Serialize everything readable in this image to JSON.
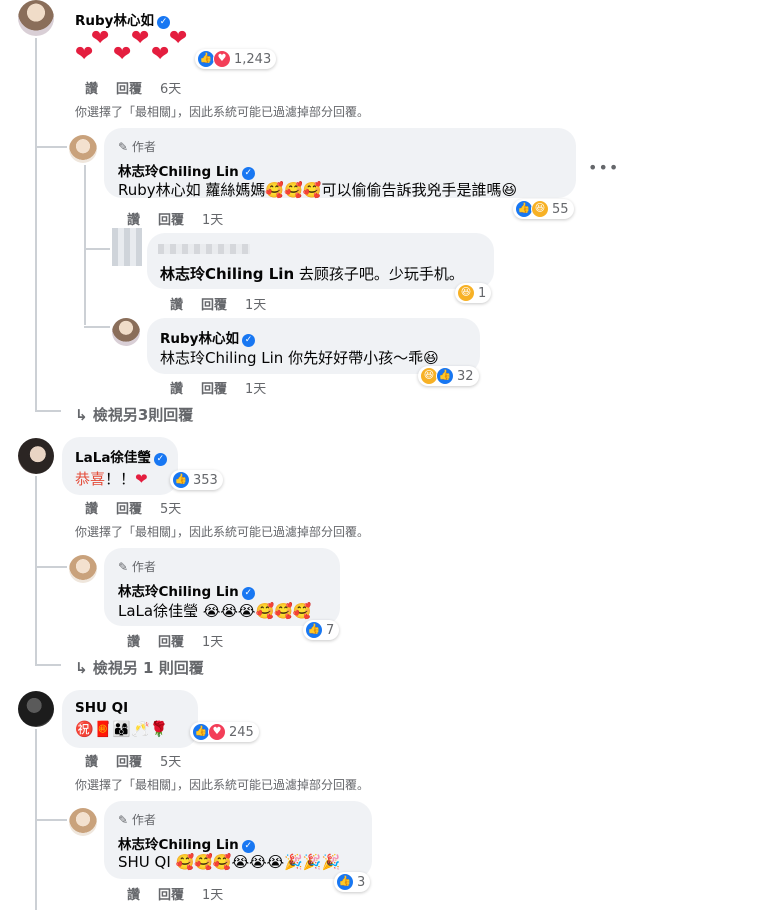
{
  "reply_label": "讚",
  "reply_btn": "回覆",
  "author_label": "作者",
  "filter_note": "你選擇了「最相關」，因此系統可能已過濾掉部分回覆。",
  "comments": [
    {
      "name": "Ruby林心如",
      "text": "❤️❤️❤️❤️❤️",
      "time": "6天",
      "count": "1,243",
      "avatar_color": "#c9b7a6"
    },
    {
      "name": "林志玲Chiling Lin",
      "text": "Ruby林心如 蘿絲媽媽🥰🥰🥰可以偷偷告訴我兇手是誰嗎😆",
      "time": "1天",
      "count": "55"
    },
    {
      "name": "",
      "text": "林志玲Chiling Lin 去顾孩子吧。少玩手机。",
      "time": "1天",
      "count": "1"
    },
    {
      "name": "Ruby林心如",
      "text": "林志玲Chiling Lin 你先好好帶小孩～乖😆",
      "time": "1天",
      "count": "32"
    },
    {
      "name": "LaLa徐佳瑩",
      "text": "恭喜！！❤️",
      "time": "5天",
      "count": "353"
    },
    {
      "name": "林志玲Chiling Lin",
      "text": "LaLa徐佳瑩 😭😭😭🥰🥰🥰",
      "time": "1天",
      "count": "7"
    },
    {
      "name": "SHU QI",
      "text": "㊗️🧧👨‍👩‍👦🥂🌹",
      "time": "5天",
      "count": "245"
    },
    {
      "name": "林志玲Chiling Lin",
      "text": "SHU QI 🥰🥰🥰😭😭😭🎉🎉🎉",
      "time": "1天",
      "count": "3"
    }
  ],
  "tag_prefix_1": "Ruby林心如",
  "text_rest_1": " 蘿絲媽媽🥰🥰🥰可以偷偷告訴我兇手是誰嗎😆",
  "tag_prefix_2": "林志玲Chiling Lin",
  "text_rest_2": " 去顾孩子吧。少玩手机。",
  "tag_prefix_3": "林志玲Chiling Lin",
  "text_rest_3": " 你先好好帶小孩～乖😆",
  "text_lala_1": "恭喜",
  "text_lala_2": "！！",
  "tag_prefix_5": "LaLa徐佳瑩",
  "text_rest_5": " 😭😭😭🥰🥰🥰",
  "tag_prefix_7": "SHU QI",
  "text_rest_7": " 🥰🥰🥰😭😭😭🎉🎉🎉",
  "view_more_1": "檢視另3則回覆",
  "view_more_2": "檢視另 1 則回覆",
  "colors": {
    "bubble": "#f0f2f5",
    "link": "#65676b",
    "like": "#1877f2",
    "love": "#f33e58",
    "haha": "#f7b125"
  }
}
